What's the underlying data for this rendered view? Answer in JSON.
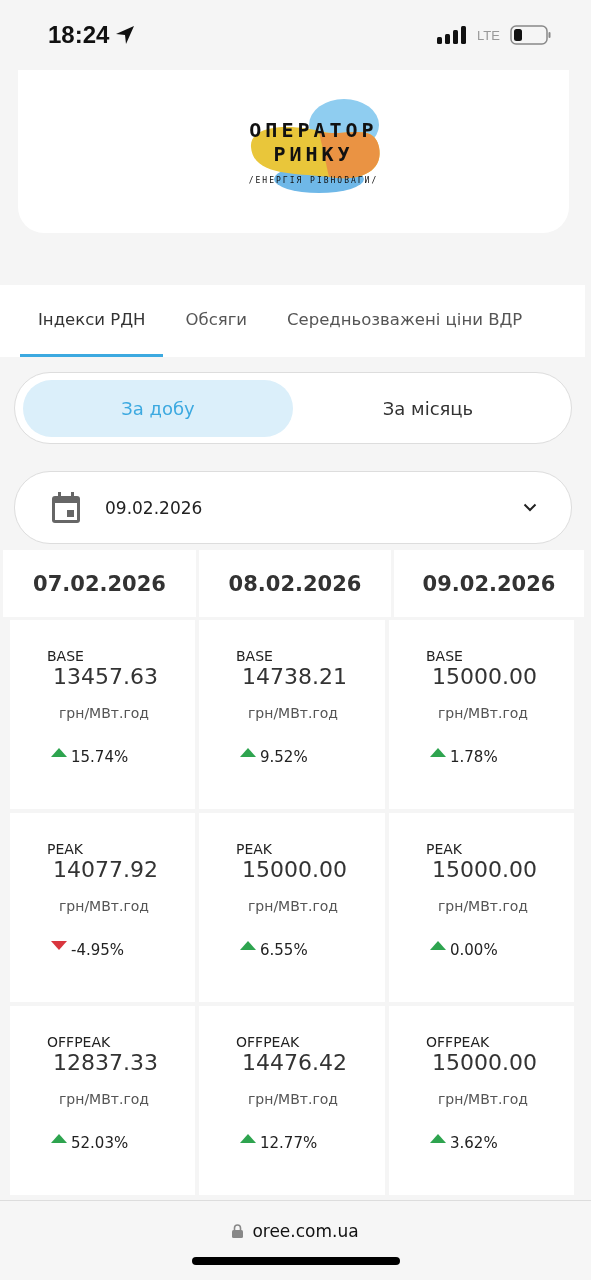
{
  "status_bar": {
    "time": "18:24",
    "network": "LTE"
  },
  "logo": {
    "line_1": "ОПЕРАТОР",
    "line_2": "РИНКУ",
    "tagline": "/ЕНЕРГІЯ РІВНОВАГИ/"
  },
  "tabs": [
    {
      "label": "Індекси РДН",
      "selected": true
    },
    {
      "label": "Обсяги",
      "selected": false
    },
    {
      "label": "Середньозважені ціни ВДР",
      "selected": false
    }
  ],
  "period": [
    {
      "label": "За добу",
      "selected": true
    },
    {
      "label": "За місяць",
      "selected": false
    }
  ],
  "date_field": {
    "value": "09.02.2026"
  },
  "columns": [
    "07.02.2026",
    "08.02.2026",
    "09.02.2026"
  ],
  "cards": [
    {
      "index": "BASE",
      "value": "13457.63",
      "unit": "грн/МВт.год",
      "change": "15.74%",
      "rising": true
    },
    {
      "index": "BASE",
      "value": "14738.21",
      "unit": "грн/МВт.год",
      "change": "9.52%",
      "rising": true
    },
    {
      "index": "BASE",
      "value": "15000.00",
      "unit": "грн/МВт.год",
      "change": "1.78%",
      "rising": true
    },
    {
      "index": "PEAK",
      "value": "14077.92",
      "unit": "грн/МВт.год",
      "change": "-4.95%",
      "rising": false
    },
    {
      "index": "PEAK",
      "value": "15000.00",
      "unit": "грн/МВт.год",
      "change": "6.55%",
      "rising": true
    },
    {
      "index": "PEAK",
      "value": "15000.00",
      "unit": "грн/МВт.год",
      "change": "0.00%",
      "rising": true
    },
    {
      "index": "OFFPEAK",
      "value": "12837.33",
      "unit": "грн/МВт.год",
      "change": "52.03%",
      "rising": true
    },
    {
      "index": "OFFPEAK",
      "value": "14476.42",
      "unit": "грн/МВт.год",
      "change": "12.77%",
      "rising": true
    },
    {
      "index": "OFFPEAK",
      "value": "15000.00",
      "unit": "грн/МВт.год",
      "change": "3.62%",
      "rising": true
    }
  ],
  "browser_bar": {
    "url": "oree.com.ua"
  }
}
